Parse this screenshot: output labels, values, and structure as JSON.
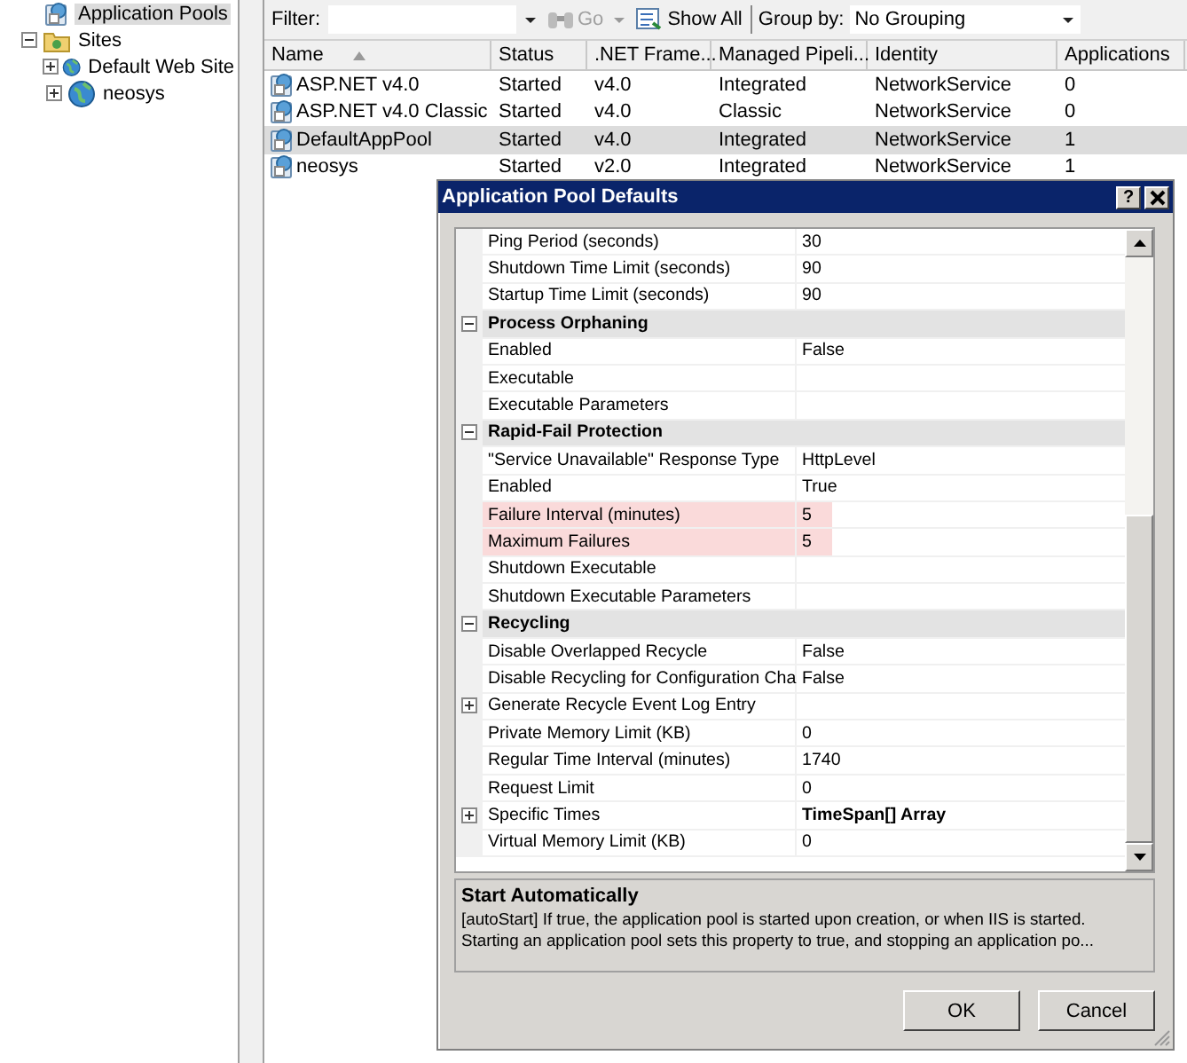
{
  "tree": {
    "items": [
      {
        "label": "Application Pools",
        "kind": "pool",
        "selected": true
      },
      {
        "label": "Sites",
        "kind": "folder",
        "selected": false,
        "expanded": true,
        "children": [
          {
            "label": "Default Web Site",
            "kind": "site",
            "selected": false,
            "expanded": false
          },
          {
            "label": "neosys",
            "kind": "site",
            "selected": false,
            "expanded": false
          }
        ]
      }
    ]
  },
  "toolbar": {
    "filter_label": "Filter:",
    "go_label": "Go",
    "go_disabled": true,
    "show_all_label": "Show All",
    "group_by_label": "Group by:",
    "group_by_value": "No Grouping"
  },
  "table": {
    "columns": [
      {
        "label": "Name",
        "sorted": true
      },
      {
        "label": "Status",
        "sorted": false
      },
      {
        "label": ".NET Frame...",
        "sorted": false
      },
      {
        "label": "Managed Pipeli...",
        "sorted": false
      },
      {
        "label": "Identity",
        "sorted": false
      },
      {
        "label": "Applications",
        "sorted": false
      }
    ],
    "rows": [
      {
        "cells": [
          "ASP.NET v4.0",
          "Started",
          "v4.0",
          "Integrated",
          "NetworkService",
          "0"
        ],
        "selected": false
      },
      {
        "cells": [
          "ASP.NET v4.0 Classic",
          "Started",
          "v4.0",
          "Classic",
          "NetworkService",
          "0"
        ],
        "selected": false
      },
      {
        "cells": [
          "DefaultAppPool",
          "Started",
          "v4.0",
          "Integrated",
          "NetworkService",
          "1"
        ],
        "selected": true
      },
      {
        "cells": [
          "neosys",
          "Started",
          "v2.0",
          "Integrated",
          "NetworkService",
          "1"
        ],
        "selected": false
      }
    ]
  },
  "dialog": {
    "title": "Application Pool Defaults",
    "help_button": "?",
    "properties": [
      {
        "kind": "property",
        "name": "Ping Period (seconds)",
        "value": "30",
        "highlighted": false,
        "expandable": false,
        "value_bold": false
      },
      {
        "kind": "property",
        "name": "Shutdown Time Limit (seconds)",
        "value": "90",
        "highlighted": false,
        "expandable": false,
        "value_bold": false
      },
      {
        "kind": "property",
        "name": "Startup Time Limit (seconds)",
        "value": "90",
        "highlighted": false,
        "expandable": false,
        "value_bold": false
      },
      {
        "kind": "category",
        "name": "Process Orphaning",
        "expanded": true
      },
      {
        "kind": "property",
        "name": "Enabled",
        "value": "False",
        "highlighted": false,
        "expandable": false,
        "value_bold": false
      },
      {
        "kind": "property",
        "name": "Executable",
        "highlighted": false,
        "expandable": false
      },
      {
        "kind": "property",
        "name": "Executable Parameters",
        "highlighted": false,
        "expandable": false
      },
      {
        "kind": "category",
        "name": "Rapid-Fail Protection",
        "expanded": true
      },
      {
        "kind": "property",
        "name": "\"Service Unavailable\" Response Type",
        "value": "HttpLevel",
        "highlighted": false,
        "expandable": false,
        "value_bold": false
      },
      {
        "kind": "property",
        "name": "Enabled",
        "value": "True",
        "highlighted": false,
        "expandable": false,
        "value_bold": false
      },
      {
        "kind": "property",
        "name": "Failure Interval (minutes)",
        "value": "5",
        "highlighted": true,
        "expandable": false,
        "value_bold": false
      },
      {
        "kind": "property",
        "name": "Maximum Failures",
        "value": "5",
        "highlighted": true,
        "expandable": false,
        "value_bold": false
      },
      {
        "kind": "property",
        "name": "Shutdown Executable",
        "highlighted": false,
        "expandable": false
      },
      {
        "kind": "property",
        "name": "Shutdown Executable Parameters",
        "highlighted": false,
        "expandable": false
      },
      {
        "kind": "category",
        "name": "Recycling",
        "expanded": true
      },
      {
        "kind": "property",
        "name": "Disable Overlapped Recycle",
        "value": "False",
        "highlighted": false,
        "expandable": false,
        "value_bold": false
      },
      {
        "kind": "property",
        "name": "Disable Recycling for Configuration Cha",
        "value": "False",
        "highlighted": false,
        "expandable": false,
        "value_bold": false
      },
      {
        "kind": "property",
        "name": "Generate Recycle Event Log Entry",
        "highlighted": false,
        "expandable": true
      },
      {
        "kind": "property",
        "name": "Private Memory Limit (KB)",
        "value": "0",
        "highlighted": false,
        "expandable": false,
        "value_bold": false
      },
      {
        "kind": "property",
        "name": "Regular Time Interval (minutes)",
        "value": "1740",
        "highlighted": false,
        "expandable": false,
        "value_bold": false
      },
      {
        "kind": "property",
        "name": "Request Limit",
        "value": "0",
        "highlighted": false,
        "expandable": false,
        "value_bold": false
      },
      {
        "kind": "property",
        "name": "Specific Times",
        "value": "TimeSpan[] Array",
        "highlighted": false,
        "expandable": true,
        "value_bold": true
      },
      {
        "kind": "property",
        "name": "Virtual Memory Limit (KB)",
        "value": "0",
        "highlighted": false,
        "expandable": false,
        "value_bold": false
      }
    ],
    "description": {
      "title": "Start Automatically",
      "text": "[autoStart] If true, the application pool is started upon creation, or when IIS is started.\n Starting an application pool sets this property to true, and stopping an application po..."
    },
    "buttons": [
      "OK",
      "Cancel"
    ]
  }
}
